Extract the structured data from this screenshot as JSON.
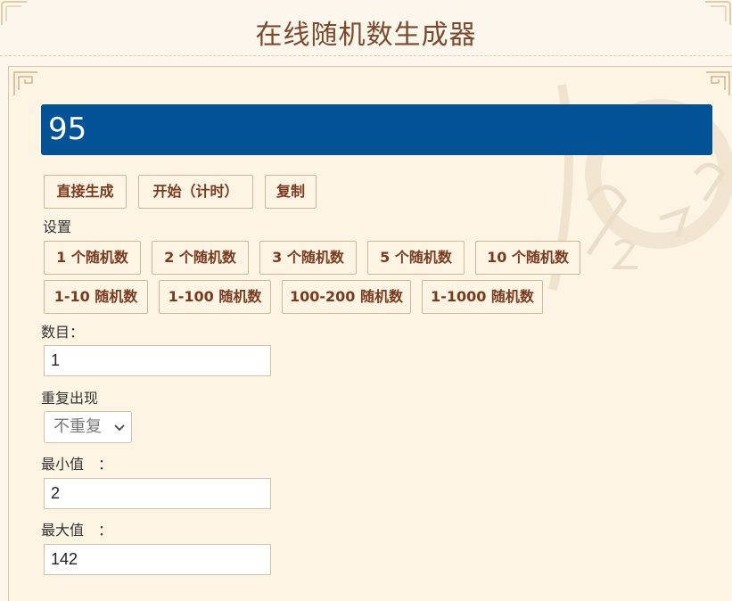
{
  "header": {
    "title": "在线随机数生成器"
  },
  "result": {
    "value": "95"
  },
  "actions": {
    "generate_label": "直接生成",
    "start_timer_label": "开始（计时）",
    "copy_label": "复制"
  },
  "settings": {
    "label": "设置",
    "count_presets": [
      "1 个随机数",
      "2 个随机数",
      "3 个随机数",
      "5 个随机数",
      "10 个随机数"
    ],
    "range_presets": [
      "1-10 随机数",
      "1-100 随机数",
      "100-200 随机数",
      "1-1000 随机数"
    ]
  },
  "form": {
    "count_label": "数目：",
    "count_value": "1",
    "repeat_label": "重复出现",
    "repeat_selected": "不重复",
    "min_label": "最小值　：",
    "min_value": "2",
    "max_label": "最大值　：",
    "max_value": "142"
  },
  "icons": {
    "corner": "ornament-corner-icon",
    "select_arrow": "chevron-down-icon"
  },
  "colors": {
    "result_bg": "#025295",
    "title": "#7b4a2c",
    "button_text": "#7a3a1e",
    "page_bg": "#fcf6ec"
  }
}
